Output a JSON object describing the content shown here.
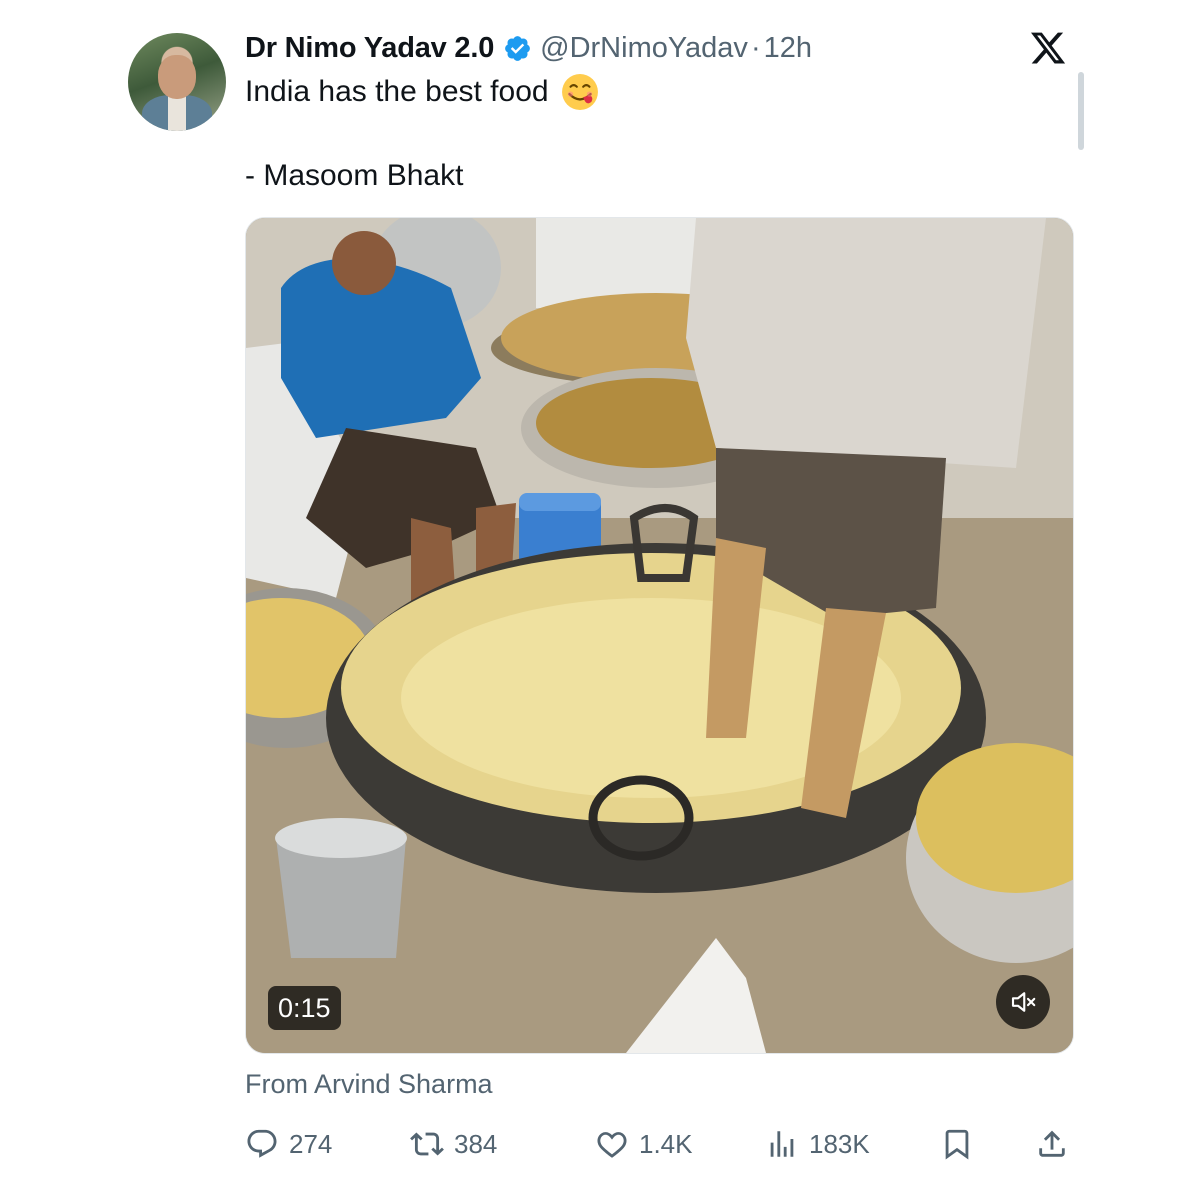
{
  "tweet": {
    "author_name": "Dr Nimo Yadav 2.0",
    "handle": "@DrNimoYadav",
    "separator": "·",
    "time": "12h",
    "text_line1": "India has the best food",
    "text_line2": "- Masoom Bhakt",
    "emoji": "face-savoring-food-emoji",
    "verified": true
  },
  "media": {
    "type": "video",
    "duration": "0:15",
    "muted": true,
    "attribution": "From Arvind Sharma"
  },
  "actions": {
    "replies": "274",
    "reposts": "384",
    "likes": "1.4K",
    "views": "183K"
  },
  "colors": {
    "text": "#0f1419",
    "secondary": "#536471",
    "verified": "#1d9bf0"
  }
}
